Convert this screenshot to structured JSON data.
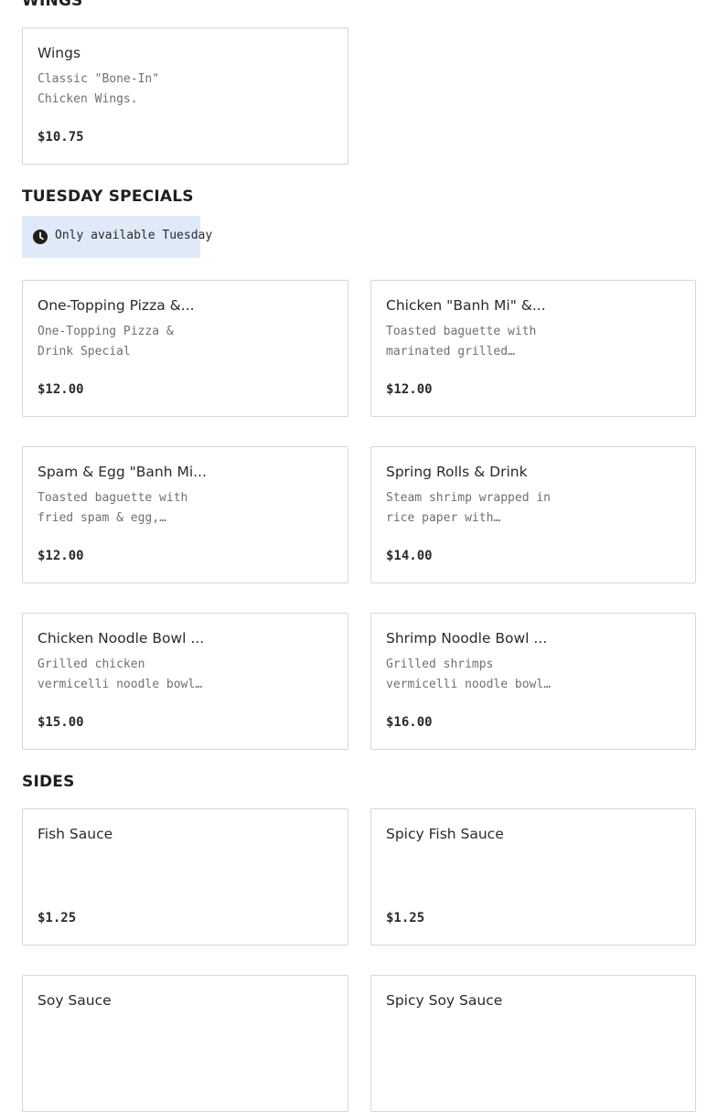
{
  "sections": [
    {
      "title": "WINGS",
      "items": [
        {
          "name": "Wings",
          "description": "Classic \"Bone-In\" Chicken Wings.",
          "price": "$10.75"
        }
      ]
    },
    {
      "title": "TUESDAY SPECIALS",
      "notice": {
        "icon": "clock-icon",
        "text": "Only available Tuesday"
      },
      "items": [
        {
          "name": "One-Topping Pizza &...",
          "description": "One-Topping Pizza & Drink Special",
          "price": "$12.00"
        },
        {
          "name": "Chicken \"Banh Mi\" &...",
          "description": "Toasted baguette with marinated grilled chicken...",
          "price": "$12.00"
        },
        {
          "name": "Spam & Egg \"Banh Mi...",
          "description": "Toasted baguette with fried spam & egg, Vietnamese...",
          "price": "$12.00"
        },
        {
          "name": "Spring Rolls & Drink",
          "description": "Steam shrimp wrapped in rice paper with lettuce,...",
          "price": "$14.00"
        },
        {
          "name": "Chicken Noodle Bowl ...",
          "description": "Grilled chicken vermicelli noodle bowl with lettuce,...",
          "price": "$15.00"
        },
        {
          "name": "Shrimp Noodle Bowl ...",
          "description": "Grilled shrimps vermicelli noodle bowl with lettuce,...",
          "price": "$16.00"
        }
      ]
    },
    {
      "title": "SIDES",
      "items": [
        {
          "name": "Fish Sauce",
          "description": "",
          "price": "$1.25"
        },
        {
          "name": "Spicy Fish Sauce",
          "description": "",
          "price": "$1.25"
        },
        {
          "name": "Soy Sauce",
          "description": "",
          "price": ""
        },
        {
          "name": "Spicy Soy Sauce",
          "description": "",
          "price": ""
        }
      ]
    }
  ],
  "colors": {
    "card_border": "#d6d6d6",
    "notice_bg": "#dfe9f8",
    "description_text": "#707070"
  }
}
